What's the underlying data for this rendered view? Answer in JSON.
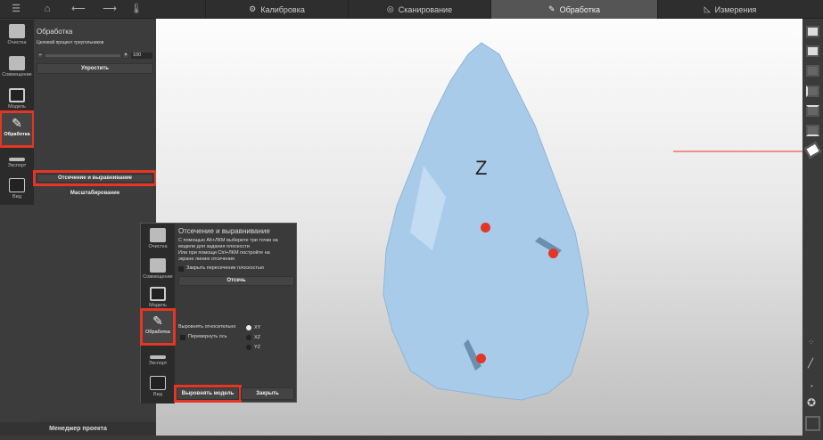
{
  "topbar": {
    "tabs": [
      {
        "label": "Калибровка",
        "icon": "gear-icon"
      },
      {
        "label": "Сканирование",
        "icon": "scan-icon"
      },
      {
        "label": "Обработка",
        "icon": "pencil-icon"
      },
      {
        "label": "Измерения",
        "icon": "ruler-icon"
      }
    ],
    "active_tab": "Обработка"
  },
  "sidebar": {
    "items": [
      {
        "label": "Очистка"
      },
      {
        "label": "Совмещение"
      },
      {
        "label": "Модель"
      },
      {
        "label": "Обработка"
      },
      {
        "label": "Экспорт"
      },
      {
        "label": "Вид"
      }
    ],
    "active": "Обработка"
  },
  "panel": {
    "title": "Обработка",
    "slider_label": "Целевой процент треугольников",
    "slider_value": "100",
    "simplify": "Упростить",
    "cut_align": "Отсечение и выравнивание",
    "scale": "Масштабирование"
  },
  "popup": {
    "title": "Отсечение и выравнивание",
    "desc1": "С помощью Alt+ЛКМ выберите три точки на",
    "desc2": "модели для задания плоскости",
    "desc3": "Или при помощи Ctrl+ЛКМ постройте на",
    "desc4": "экране линию отсечения",
    "close_plane": "Закрыть пересечение плоскостью",
    "cut": "Отсечь",
    "align_rel": "Выровнять относительно",
    "flip_axis": "Перевернуть ось",
    "axes": [
      "XY",
      "XZ",
      "YZ"
    ],
    "selected_axis": "XY",
    "align_model": "Выровнять модель",
    "close": "Закрыть"
  },
  "viewport": {
    "axis_label": "Z"
  },
  "footer": {
    "label": "Менеджер проекта"
  },
  "colors": {
    "highlight": "#e53524",
    "model": "#a9cbea"
  }
}
